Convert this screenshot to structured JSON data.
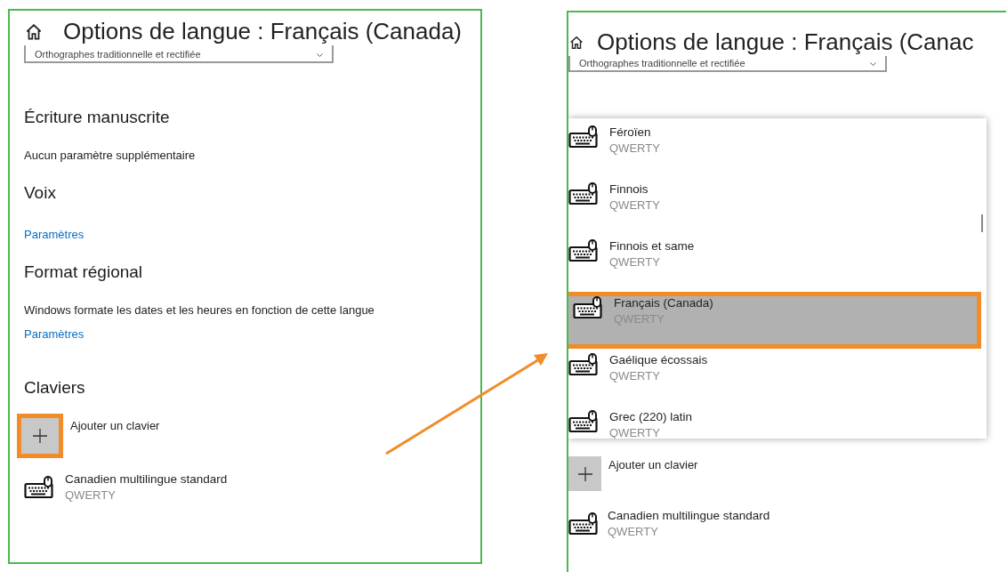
{
  "left_panel": {
    "title": "Options de langue : Français (Canada)",
    "dropdown": "Orthographes traditionnelle et rectifiée",
    "sections": [
      {
        "heading": "Écriture manuscrite",
        "lines": [
          {
            "kind": "text",
            "text": "Aucun paramètre supplémentaire"
          }
        ]
      },
      {
        "heading": "Voix",
        "lines": [
          {
            "kind": "link",
            "text": "Paramètres"
          }
        ]
      },
      {
        "heading": "Format régional",
        "lines": [
          {
            "kind": "text",
            "text": "Windows formate les dates et les heures en fonction de cette langue"
          },
          {
            "kind": "link",
            "text": "Paramètres"
          }
        ]
      }
    ],
    "keyboards_heading": "Claviers",
    "add_keyboard": {
      "label": "Ajouter un clavier",
      "highlighted": true
    },
    "keyboards": [
      {
        "name": "Canadien multilingue standard",
        "layout": "QWERTY"
      }
    ]
  },
  "right_panel": {
    "title": "Options de langue : Français (Canac",
    "dropdown": "Orthographes traditionnelle et rectifiée",
    "picker": [
      {
        "name": "Féroïen",
        "layout": "QWERTY",
        "selected": false,
        "highlighted": false
      },
      {
        "name": "Finnois",
        "layout": "QWERTY",
        "selected": false,
        "highlighted": false
      },
      {
        "name": "Finnois et same",
        "layout": "QWERTY",
        "selected": false,
        "highlighted": false
      },
      {
        "name": "Français (Canada)",
        "layout": "QWERTY",
        "selected": true,
        "highlighted": true
      },
      {
        "name": "Gaélique écossais",
        "layout": "QWERTY",
        "selected": false,
        "highlighted": false
      },
      {
        "name": "Grec (220) latin",
        "layout": "QWERTY",
        "selected": false,
        "highlighted": false
      }
    ],
    "add_keyboard": {
      "label": "Ajouter un clavier",
      "highlighted": false
    },
    "keyboards": [
      {
        "name": "Canadien multilingue standard",
        "layout": "QWERTY"
      }
    ]
  }
}
